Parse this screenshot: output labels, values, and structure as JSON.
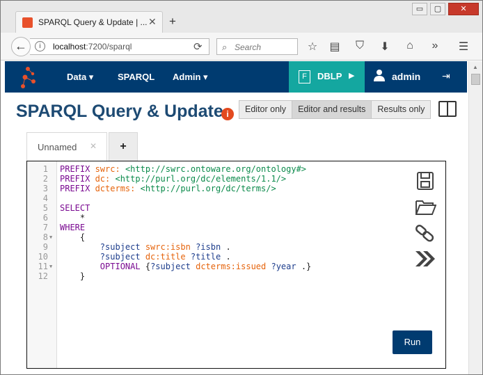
{
  "browser": {
    "tab_title": "SPARQL Query & Update | ...",
    "tab_close": "✕",
    "new_tab": "+",
    "url_host": "localhost",
    "url_path": ":7200/sparql",
    "search_placeholder": "Search",
    "window_controls": {
      "minimize": "▭",
      "maximize": "▢",
      "close": "✕"
    }
  },
  "header": {
    "menu": [
      {
        "label": "Data ▾"
      },
      {
        "label": "SPARQL"
      },
      {
        "label": "Admin ▾"
      }
    ],
    "repo_badge": "F",
    "repo_name": "DBLP",
    "repo_arrow": "▶",
    "user_name": "admin"
  },
  "page": {
    "title": "SPARQL Query & Update",
    "info": "i",
    "modes": [
      {
        "label": "Editor only",
        "active": false
      },
      {
        "label": "Editor and results",
        "active": true
      },
      {
        "label": "Results only",
        "active": false
      }
    ]
  },
  "query_tabs": {
    "active_tab": "Unnamed",
    "close": "✕",
    "add": "+"
  },
  "editor": {
    "run_label": "Run",
    "lines": [
      {
        "n": "1",
        "fold": "",
        "tokens": [
          [
            "kw",
            "PREFIX "
          ],
          [
            "pf",
            "swrc: "
          ],
          [
            "iri",
            "<http://swrc.ontoware.org/ontology#>"
          ]
        ]
      },
      {
        "n": "2",
        "fold": "",
        "tokens": [
          [
            "kw",
            "PREFIX "
          ],
          [
            "pf",
            "dc: "
          ],
          [
            "iri",
            "<http://purl.org/dc/elements/1.1/>"
          ]
        ]
      },
      {
        "n": "3",
        "fold": "",
        "tokens": [
          [
            "kw",
            "PREFIX "
          ],
          [
            "pf",
            "dcterms: "
          ],
          [
            "iri",
            "<http://purl.org/dc/terms/>"
          ]
        ]
      },
      {
        "n": "4",
        "fold": "",
        "tokens": []
      },
      {
        "n": "5",
        "fold": "",
        "tokens": [
          [
            "kw",
            "SELECT"
          ]
        ]
      },
      {
        "n": "6",
        "fold": "",
        "tokens": [
          [
            "pl",
            "    *"
          ]
        ]
      },
      {
        "n": "7",
        "fold": "",
        "tokens": [
          [
            "kw",
            "WHERE"
          ]
        ]
      },
      {
        "n": "8",
        "fold": "▼",
        "tokens": [
          [
            "pl",
            "    {"
          ]
        ]
      },
      {
        "n": "9",
        "fold": "",
        "tokens": [
          [
            "pl",
            "        "
          ],
          [
            "var",
            "?subject "
          ],
          [
            "pf",
            "swrc:isbn "
          ],
          [
            "var",
            "?isbn "
          ],
          [
            "pl",
            "."
          ]
        ]
      },
      {
        "n": "10",
        "fold": "",
        "tokens": [
          [
            "pl",
            "        "
          ],
          [
            "var",
            "?subject "
          ],
          [
            "pf",
            "dc:title "
          ],
          [
            "var",
            "?title "
          ],
          [
            "pl",
            "."
          ]
        ]
      },
      {
        "n": "11",
        "fold": "▼",
        "tokens": [
          [
            "pl",
            "        "
          ],
          [
            "kw",
            "OPTIONAL "
          ],
          [
            "pl",
            "{"
          ],
          [
            "var",
            "?subject "
          ],
          [
            "pf",
            "dcterms:issued "
          ],
          [
            "var",
            "?year "
          ],
          [
            "pl",
            ".}"
          ]
        ]
      },
      {
        "n": "12",
        "fold": "",
        "tokens": [
          [
            "pl",
            "    }"
          ]
        ]
      }
    ]
  }
}
